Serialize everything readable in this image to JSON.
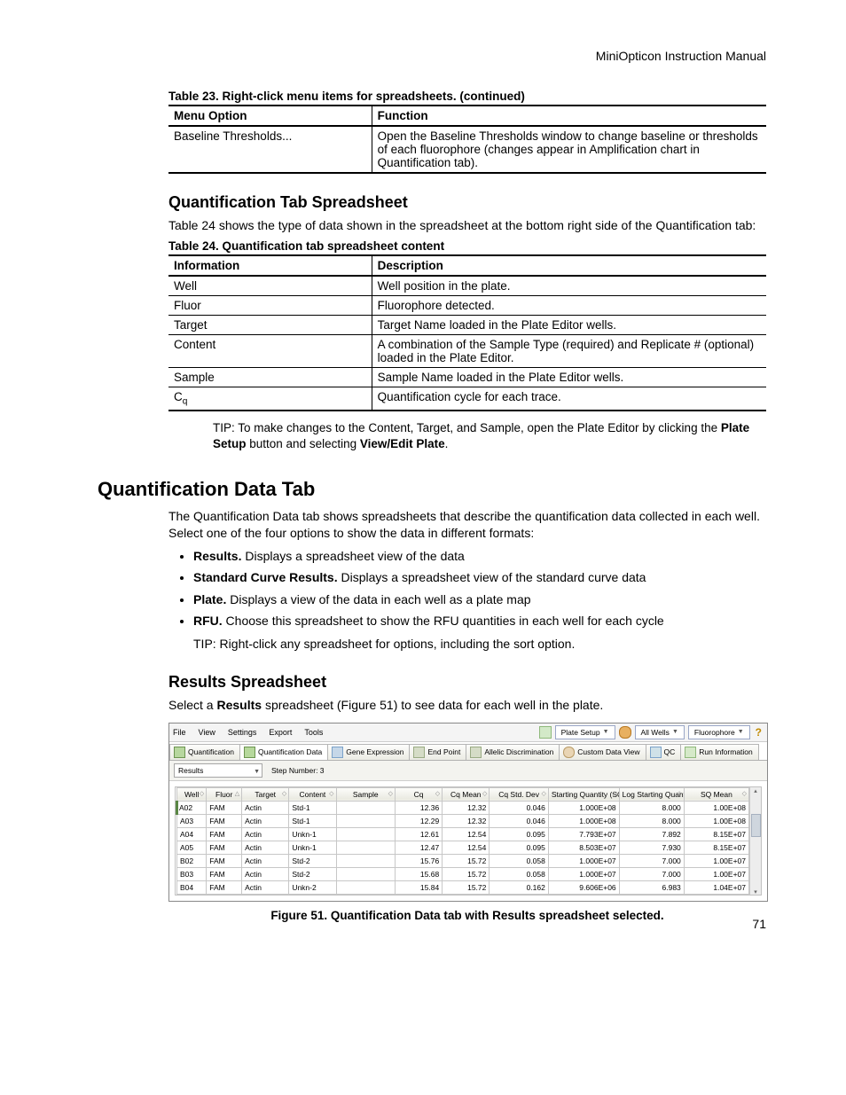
{
  "header": {
    "manual_title": "MiniOpticon Instruction Manual"
  },
  "page_number": "71",
  "table23": {
    "caption": "Table 23. Right-click menu items for spreadsheets.  (continued)",
    "head": [
      "Menu Option",
      "Function"
    ],
    "rows": [
      {
        "c1": "Baseline Thresholds...",
        "c2": "Open the Baseline Thresholds window to change baseline or thresholds of each fluorophore (changes appear in Amplification chart in Quantification tab)."
      }
    ]
  },
  "sec1": {
    "title": "Quantification Tab Spreadsheet",
    "para": "Table 24 shows the type of data shown in the spreadsheet at the bottom right side of the Quantification tab:"
  },
  "table24": {
    "caption": "Table 24. Quantification tab spreadsheet content",
    "head": [
      "Information",
      "Description"
    ],
    "rows": [
      {
        "c1": "Well",
        "c2": "Well position in the plate."
      },
      {
        "c1": "Fluor",
        "c2": "Fluorophore detected."
      },
      {
        "c1": "Target",
        "c2": "Target Name loaded in the Plate Editor wells."
      },
      {
        "c1": "Content",
        "c2": "A combination of the Sample Type (required) and Replicate # (optional) loaded in the Plate Editor."
      },
      {
        "c1": "Sample",
        "c2": "Sample Name loaded in the Plate Editor wells."
      },
      {
        "c1_html": "C<sub>q</sub>",
        "c2": "Quantification cycle for each trace."
      }
    ]
  },
  "tip1": {
    "prefix": "TIP: To make changes to the Content, Target, and Sample, open the Plate Editor by clicking the ",
    "b1": "Plate Setup",
    "mid": " button and selecting ",
    "b2": "View/Edit Plate",
    "suffix": "."
  },
  "sec2": {
    "title": "Quantification Data Tab",
    "para": "The Quantification Data tab shows spreadsheets that describe the quantification data collected in each well. Select one of the four options to show the data in different formats:",
    "bullets": [
      {
        "b": "Results.",
        "t": " Displays a spreadsheet view of the data"
      },
      {
        "b": "Standard Curve Results.",
        "t": " Displays a spreadsheet view of the standard curve data"
      },
      {
        "b": "Plate.",
        "t": " Displays a view of the data in each well as a plate map"
      },
      {
        "b": "RFU.",
        "t": " Choose this spreadsheet to show the RFU quantities in each well for each cycle"
      }
    ],
    "bullet_tip": "TIP: Right-click any spreadsheet for options, including the sort option."
  },
  "sec3": {
    "title": "Results Spreadsheet",
    "para_pre": "Select a ",
    "para_b": "Results",
    "para_post": " spreadsheet (Figure 51) to see data for each well in the plate."
  },
  "screenshot": {
    "menubar": [
      "File",
      "View",
      "Settings",
      "Export",
      "Tools"
    ],
    "toolbar_right": {
      "plate_setup": "Plate Setup",
      "wells": "All Wells",
      "fluor": "Fluorophore"
    },
    "tabs": [
      "Quantification",
      "Quantification Data",
      "Gene Expression",
      "End Point",
      "Allelic Discrimination",
      "Custom Data View",
      "QC",
      "Run Information"
    ],
    "active_tab_index": 1,
    "dropdown_value": "Results",
    "step_label": "Step Number:  3",
    "grid_headers": [
      "Well",
      "Fluor",
      "Target",
      "Content",
      "Sample",
      "Cq",
      "Cq Mean",
      "Cq Std. Dev",
      "Starting Quantity (SQ)",
      "Log Starting Quantity",
      "SQ Mean"
    ],
    "grid_rows": [
      {
        "well": "A02",
        "fluor": "FAM",
        "target": "Actin",
        "content": "Std-1",
        "sample": "",
        "cq": "12.36",
        "cqm": "12.32",
        "cqsd": "0.046",
        "sq": "1.000E+08",
        "lsq": "8.000",
        "sqm": "1.00E+08",
        "sel": true
      },
      {
        "well": "A03",
        "fluor": "FAM",
        "target": "Actin",
        "content": "Std-1",
        "sample": "",
        "cq": "12.29",
        "cqm": "12.32",
        "cqsd": "0.046",
        "sq": "1.000E+08",
        "lsq": "8.000",
        "sqm": "1.00E+08"
      },
      {
        "well": "A04",
        "fluor": "FAM",
        "target": "Actin",
        "content": "Unkn-1",
        "sample": "",
        "cq": "12.61",
        "cqm": "12.54",
        "cqsd": "0.095",
        "sq": "7.793E+07",
        "lsq": "7.892",
        "sqm": "8.15E+07"
      },
      {
        "well": "A05",
        "fluor": "FAM",
        "target": "Actin",
        "content": "Unkn-1",
        "sample": "",
        "cq": "12.47",
        "cqm": "12.54",
        "cqsd": "0.095",
        "sq": "8.503E+07",
        "lsq": "7.930",
        "sqm": "8.15E+07"
      },
      {
        "well": "B02",
        "fluor": "FAM",
        "target": "Actin",
        "content": "Std-2",
        "sample": "",
        "cq": "15.76",
        "cqm": "15.72",
        "cqsd": "0.058",
        "sq": "1.000E+07",
        "lsq": "7.000",
        "sqm": "1.00E+07"
      },
      {
        "well": "B03",
        "fluor": "FAM",
        "target": "Actin",
        "content": "Std-2",
        "sample": "",
        "cq": "15.68",
        "cqm": "15.72",
        "cqsd": "0.058",
        "sq": "1.000E+07",
        "lsq": "7.000",
        "sqm": "1.00E+07"
      },
      {
        "well": "B04",
        "fluor": "FAM",
        "target": "Actin",
        "content": "Unkn-2",
        "sample": "",
        "cq": "15.84",
        "cqm": "15.72",
        "cqsd": "0.162",
        "sq": "9.606E+06",
        "lsq": "6.983",
        "sqm": "1.04E+07"
      }
    ]
  },
  "figure_caption": "Figure 51. Quantification Data tab with Results spreadsheet selected."
}
